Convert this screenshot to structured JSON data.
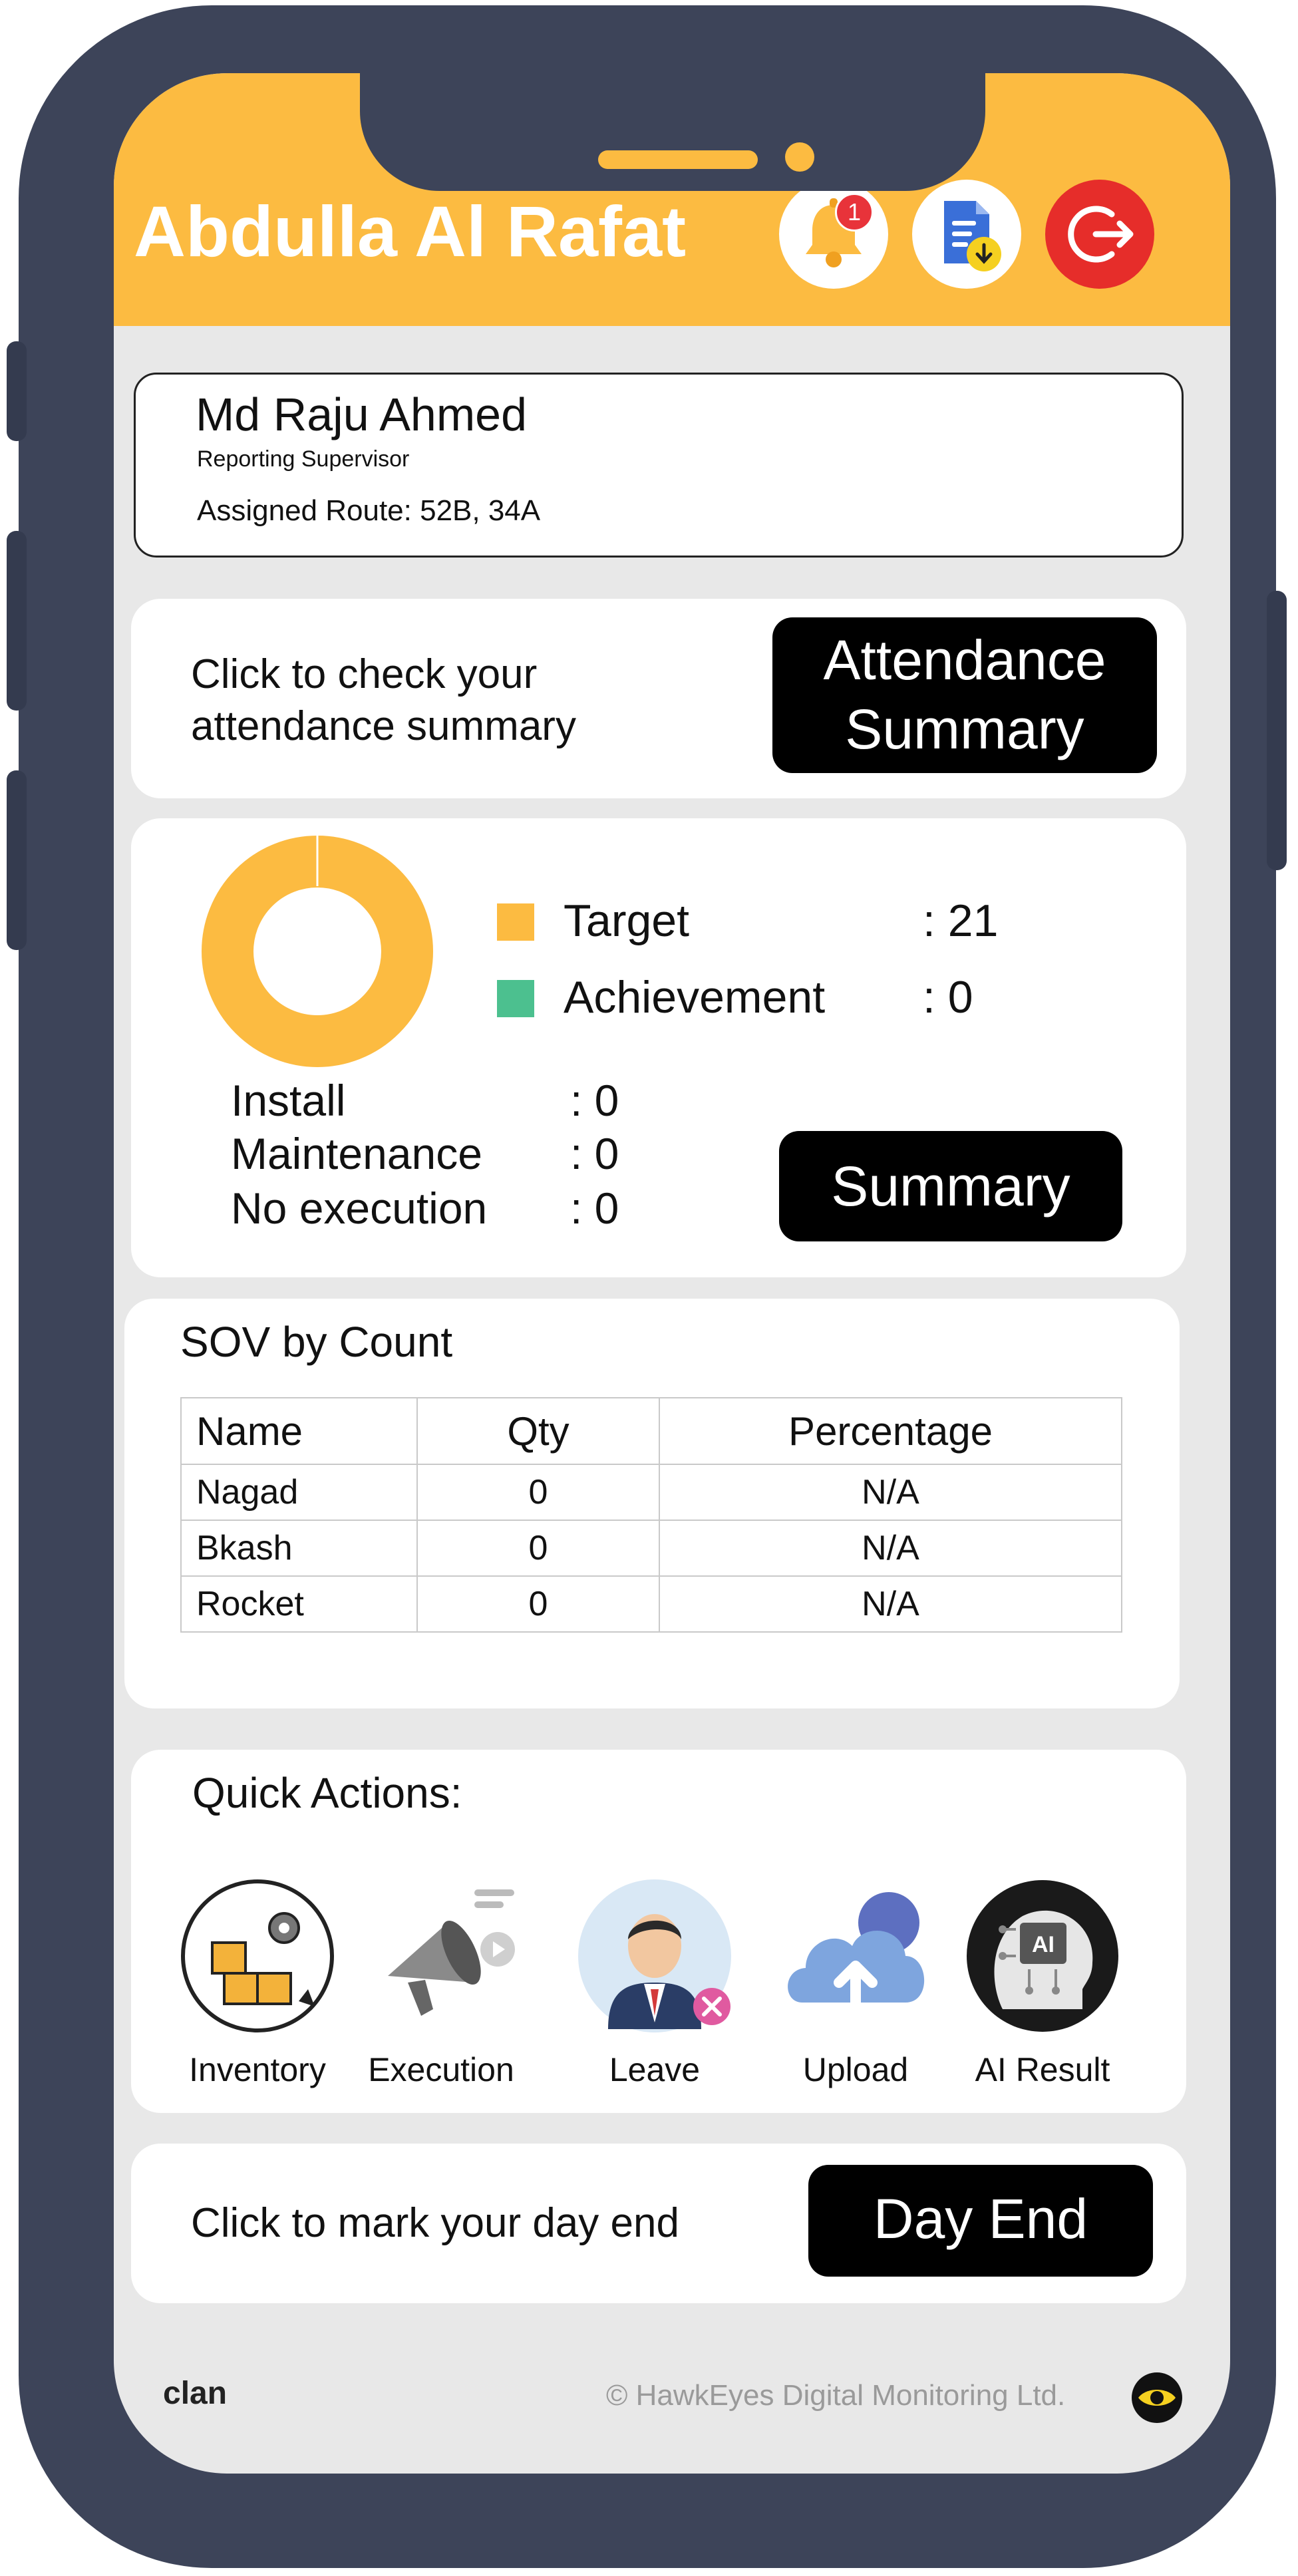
{
  "header": {
    "user_name": "Abdulla Al Rafat",
    "notification_count": "1"
  },
  "supervisor": {
    "name": "Md Raju Ahmed",
    "role": "Reporting Supervisor",
    "route": "Assigned Route: 52B, 34A"
  },
  "attendance": {
    "prompt": "Click to check your attendance summary",
    "button_line1": "Attendance",
    "button_line2": "Summary"
  },
  "performance": {
    "target_label": "Target",
    "target_value": ": 21",
    "achievement_label": "Achievement",
    "achievement_value": ": 0",
    "install_label": "Install",
    "install_value": ": 0",
    "maintenance_label": "Maintenance",
    "maintenance_value": ": 0",
    "no_execution_label": "No execution",
    "no_execution_value": ": 0",
    "summary_button": "Summary"
  },
  "chart_data": {
    "type": "pie",
    "categories": [
      "Target",
      "Achievement"
    ],
    "values": [
      21,
      0
    ],
    "colors": [
      "#fcbb41",
      "#4cc08f"
    ]
  },
  "sov": {
    "title": "SOV by Count",
    "headers": [
      "Name",
      "Qty",
      "Percentage"
    ],
    "rows": [
      [
        "Nagad",
        "0",
        "N/A"
      ],
      [
        "Bkash",
        "0",
        "N/A"
      ],
      [
        "Rocket",
        "0",
        "N/A"
      ]
    ]
  },
  "quick_actions": {
    "title": "Quick Actions:",
    "items": [
      {
        "label": "Inventory",
        "icon": "inventory-icon"
      },
      {
        "label": "Execution",
        "icon": "megaphone-icon"
      },
      {
        "label": "Leave",
        "icon": "leave-icon"
      },
      {
        "label": "Upload",
        "icon": "cloud-upload-icon"
      },
      {
        "label": "AI Result",
        "icon": "ai-head-icon"
      }
    ]
  },
  "day_end": {
    "prompt": "Click to mark your day end",
    "button": "Day End"
  },
  "footer": {
    "brand": "clan",
    "copyright": "© HawkEyes Digital Monitoring Ltd."
  },
  "colors": {
    "accent": "#fcbb41",
    "achievement": "#4cc08f",
    "logout": "#e62d2a",
    "phone_frame": "#3d4459"
  }
}
